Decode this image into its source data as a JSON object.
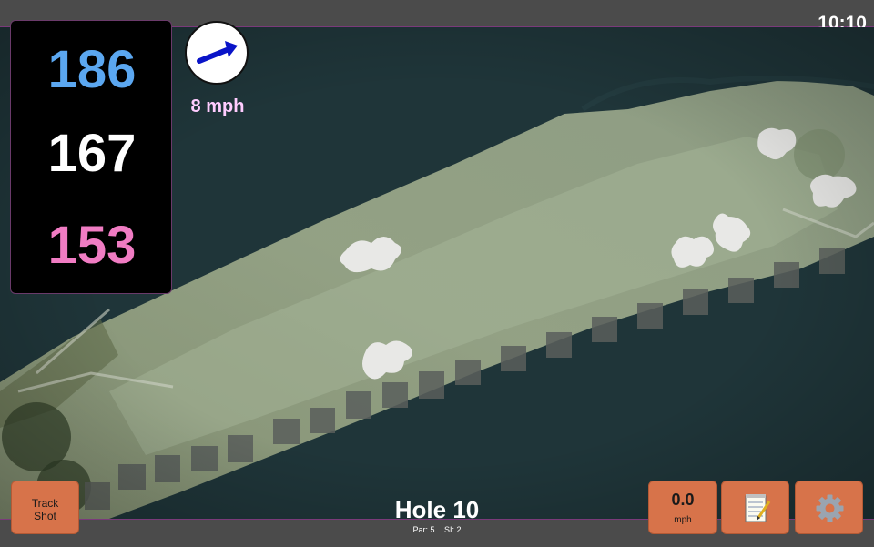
{
  "status": {
    "time": "10:10"
  },
  "yardages": {
    "back": "186",
    "middle": "167",
    "front": "153",
    "colors": {
      "back": "#5ba7f0",
      "middle": "#ffffff",
      "front": "#f07cc3"
    }
  },
  "wind": {
    "speed": "8 mph",
    "arrow_color": "#0a14c8",
    "icon": "wind-direction-arrow"
  },
  "hole": {
    "title": "Hole 10",
    "par": "Par: 5",
    "si": "SI: 2"
  },
  "buttons": {
    "track_shot": {
      "line1": "Track",
      "line2": "Shot"
    },
    "speed": {
      "value": "0.0",
      "unit": "mph"
    },
    "notes": {
      "icon": "notepad-icon"
    },
    "settings": {
      "icon": "gear-icon"
    }
  },
  "colors": {
    "button_bg": "#d7734a",
    "map_water": "#1f3539",
    "fairway": "#9aa98a",
    "bunker": "#e6e6e6"
  }
}
